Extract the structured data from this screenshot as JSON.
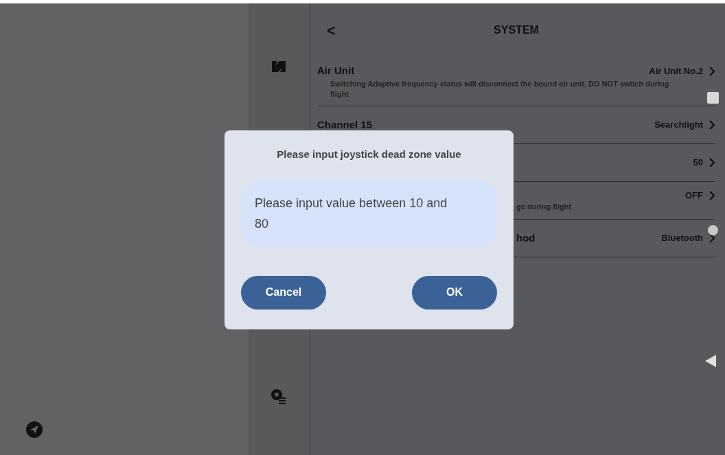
{
  "header": {
    "back": "<",
    "title": "SYSTEM"
  },
  "rows": [
    {
      "label": "Air Unit",
      "value": "Air Unit No.2",
      "note": "Switching Adaptive frequency status will disconnect the bound air unit, DO NOT switch during flight",
      "covered": false
    },
    {
      "label": "Channel 15",
      "value": "Searchlight",
      "covered": false
    },
    {
      "value": "50"
    },
    {
      "value": "OFF",
      "note": "ge during flight",
      "covered": true
    },
    {
      "label": "hod",
      "value": "Bluetooth",
      "covered": true
    }
  ],
  "dialog": {
    "title": "Please input joystick dead zone value",
    "field": {
      "placeholder": "Please input value between 10 and 80"
    },
    "buttons": [
      "Cancel",
      "OK"
    ]
  }
}
